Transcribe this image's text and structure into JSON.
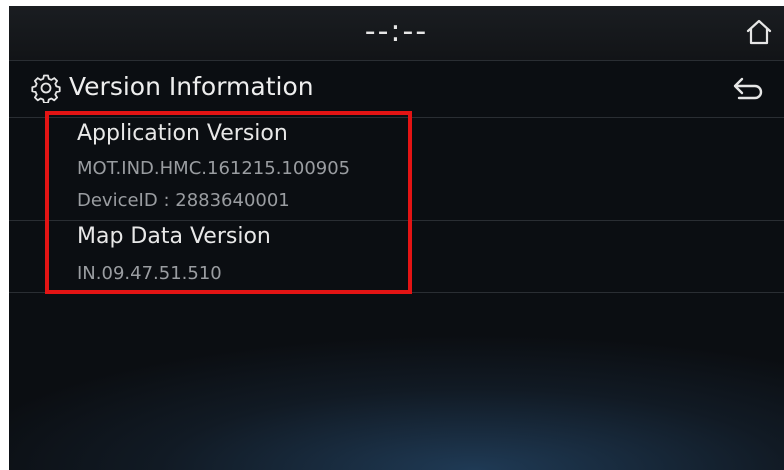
{
  "status_bar": {
    "clock": "--:--",
    "home_icon": "home-icon"
  },
  "header": {
    "title": "Version Information",
    "settings_icon": "gear-icon",
    "back_icon": "back-arrow-icon"
  },
  "items": [
    {
      "label": "Application Version",
      "values": [
        "MOT.IND.HMC.161215.100905",
        "DeviceID : 2883640001"
      ]
    },
    {
      "label": "Map Data Version",
      "values": [
        "IN.09.47.51.510"
      ]
    }
  ],
  "colors": {
    "highlight": "#e31414",
    "background": "#0b0e12",
    "primary_text": "#e8e8e8",
    "secondary_text": "#9a9da1"
  }
}
